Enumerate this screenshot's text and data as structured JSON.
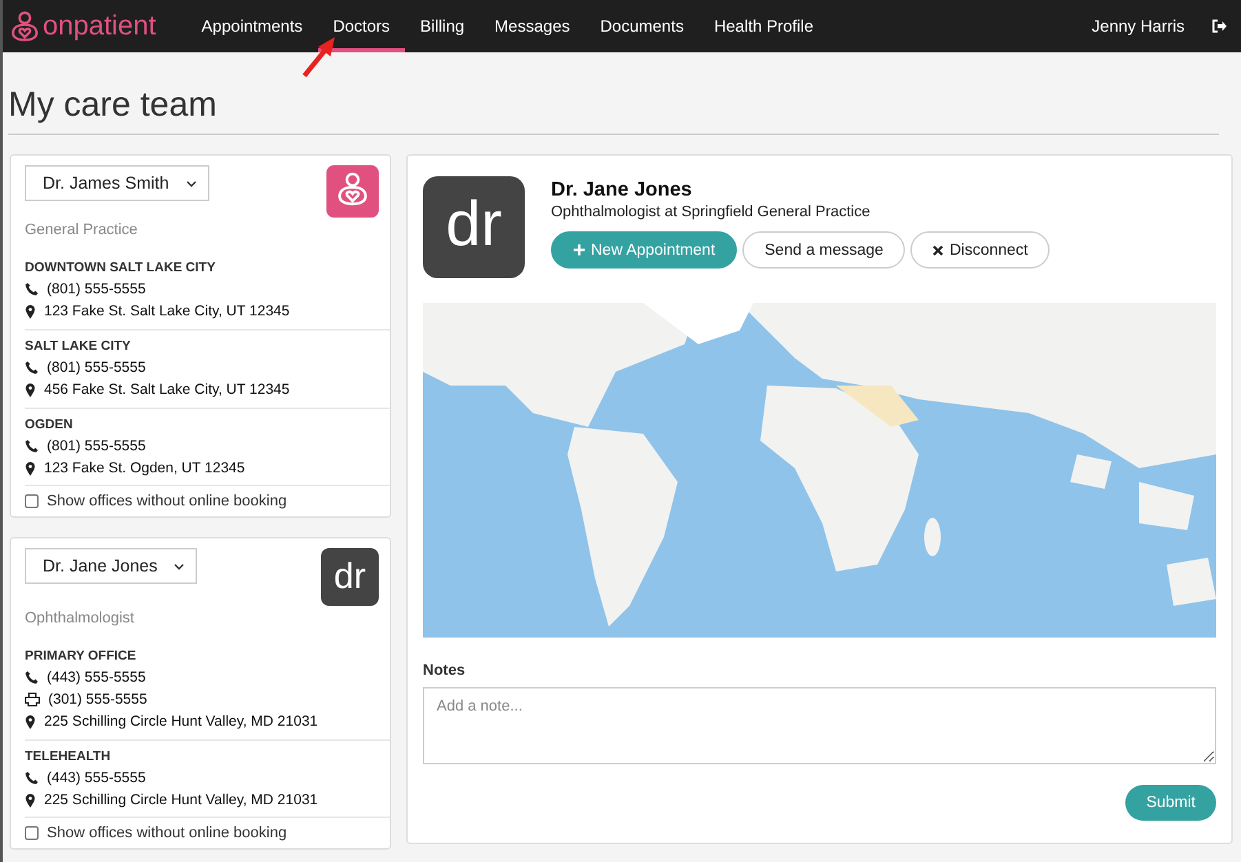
{
  "nav": {
    "logo": "onpatient",
    "items": [
      {
        "label": "Appointments",
        "selected": false
      },
      {
        "label": "Doctors",
        "selected": true
      },
      {
        "label": "Billing",
        "selected": false
      },
      {
        "label": "Messages",
        "selected": false
      },
      {
        "label": "Documents",
        "selected": false
      },
      {
        "label": "Health Profile",
        "selected": false
      }
    ],
    "user": "Jenny Harris"
  },
  "page_title": "My care team",
  "doctor_cards": [
    {
      "doctor": "Dr. James Smith",
      "avatar": {
        "kind": "logo"
      },
      "specialty": "General Practice",
      "offices": [
        {
          "name": "DOWNTOWN SALT LAKE CITY",
          "lines": [
            {
              "kind": "phone",
              "text": "(801) 555-5555"
            },
            {
              "kind": "address",
              "text": "123 Fake St. Salt Lake City, UT 12345"
            }
          ]
        },
        {
          "name": "SALT LAKE CITY",
          "lines": [
            {
              "kind": "phone",
              "text": "(801) 555-5555"
            },
            {
              "kind": "address",
              "text": "456 Fake St. Salt Lake City, UT 12345"
            }
          ]
        },
        {
          "name": "OGDEN",
          "lines": [
            {
              "kind": "phone",
              "text": "(801) 555-5555"
            },
            {
              "kind": "address",
              "text": "123 Fake St. Ogden, UT 12345"
            }
          ]
        }
      ],
      "show_offline": {
        "label": "Show offices without online booking",
        "checked": false
      }
    },
    {
      "doctor": "Dr. Jane Jones",
      "avatar": {
        "kind": "initials",
        "text": "dr"
      },
      "specialty": "Ophthalmologist",
      "offices": [
        {
          "name": "PRIMARY OFFICE",
          "lines": [
            {
              "kind": "phone",
              "text": "(443) 555-5555"
            },
            {
              "kind": "fax",
              "text": "(301) 555-5555"
            },
            {
              "kind": "address",
              "text": "225 Schilling Circle Hunt Valley, MD 21031"
            }
          ]
        },
        {
          "name": "TELEHEALTH",
          "lines": [
            {
              "kind": "phone",
              "text": "(443) 555-5555"
            },
            {
              "kind": "address",
              "text": "225 Schilling Circle Hunt Valley, MD 21031"
            }
          ]
        }
      ],
      "show_offline": {
        "label": "Show offices without online booking",
        "checked": false
      }
    }
  ],
  "detail": {
    "avatar_text": "dr",
    "name": "Dr. Jane Jones",
    "subtitle": "Ophthalmologist at Springfield General Practice",
    "buttons": [
      {
        "kind": "primary",
        "label": "New Appointment"
      },
      {
        "kind": "plain",
        "label": "Send a message"
      },
      {
        "kind": "disconnect",
        "label": "Disconnect"
      }
    ],
    "notes_label": "Notes",
    "notes_placeholder": "Add a note...",
    "submit": "Submit"
  }
}
